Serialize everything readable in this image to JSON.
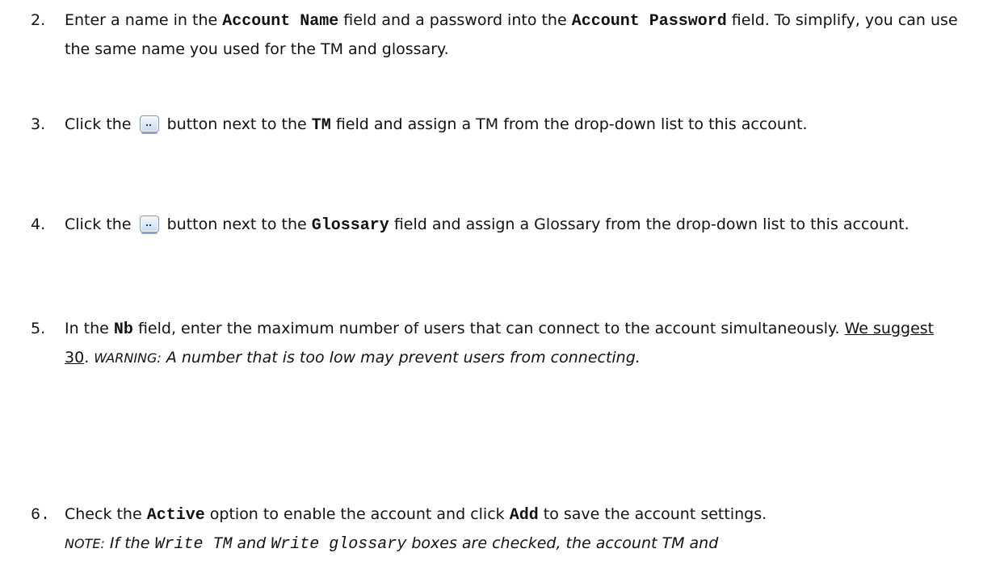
{
  "steps": [
    {
      "number": "2.",
      "t1": "Enter a name in the ",
      "c1": "Account Name",
      "t2": " field and a password into the ",
      "c2": "Account Password",
      "t3": " field. To simplify, you can use the same name you used for the TM and glossary."
    },
    {
      "number": "3.",
      "t1": "Click the ",
      "t2": " button next to the ",
      "c1": "TM",
      "t3": " field and assign a TM from the drop-down list to this account."
    },
    {
      "number": "4.",
      "t1": "Click the ",
      "t2": " button next to the ",
      "c1": "Glossary",
      "t3": " field and assign a Glossary from the drop-down list to this account."
    },
    {
      "number": "5.",
      "t1": "In the ",
      "c1": "Nb",
      "t2": " field, enter the maximum number of users that can connect to the account simultaneously. ",
      "u1": "We suggest 30",
      "t3": ". ",
      "sc1": "WARNING:",
      "i1": " A number that is too low may prevent users from connecting."
    },
    {
      "number": "6.",
      "t1": "Check the ",
      "c1": "Active",
      "t2": " option to enable the account and click ",
      "c2": "Add",
      "t3": " to save the account settings.",
      "sc1": "NOTE:",
      "i1": " If the ",
      "m1": "Write TM",
      "i2": " and ",
      "m2": "Write glossary",
      "i3": " boxes are checked, the account TM and"
    }
  ],
  "icons": {
    "browse_button": "ellipsis-button-icon"
  }
}
